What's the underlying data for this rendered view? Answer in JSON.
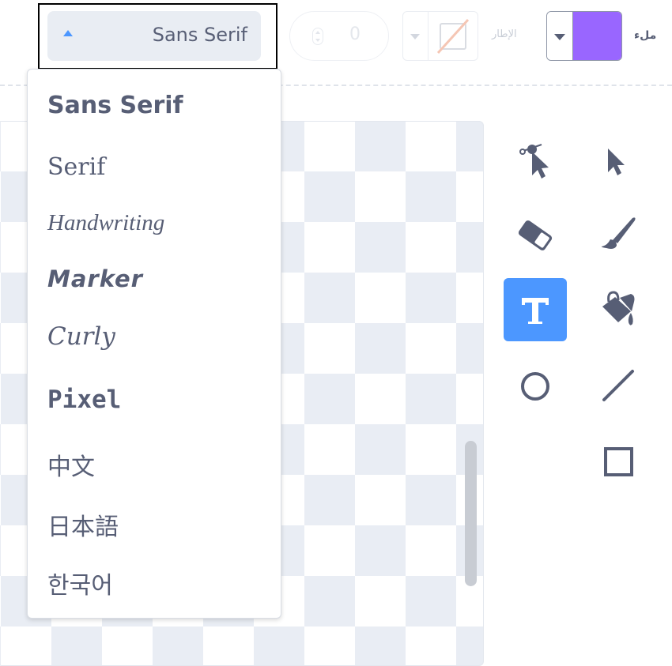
{
  "toolbar": {
    "font_value": "Sans Serif",
    "font_size_value": "0",
    "outline_label": "الإطار",
    "fill_label": "ملء",
    "fill_color": "#9966FF",
    "outline_color": "none"
  },
  "font_menu": {
    "options": [
      "Sans Serif",
      "Serif",
      "Handwriting",
      "Marker",
      "Curly",
      "Pixel",
      "中文",
      "日本語",
      "한국어"
    ]
  },
  "tools": [
    {
      "name": "reshape-icon",
      "active": false
    },
    {
      "name": "select-icon",
      "active": false
    },
    {
      "name": "eraser-icon",
      "active": false
    },
    {
      "name": "brush-icon",
      "active": false
    },
    {
      "name": "text-icon",
      "active": true
    },
    {
      "name": "fill-bucket-icon",
      "active": false
    },
    {
      "name": "circle-icon",
      "active": false
    },
    {
      "name": "line-icon",
      "active": false
    },
    {
      "name": "rectangle-icon",
      "active": false
    }
  ],
  "colors": {
    "accent": "#4C97FF",
    "text": "#575E75",
    "fill": "#9966FF"
  }
}
